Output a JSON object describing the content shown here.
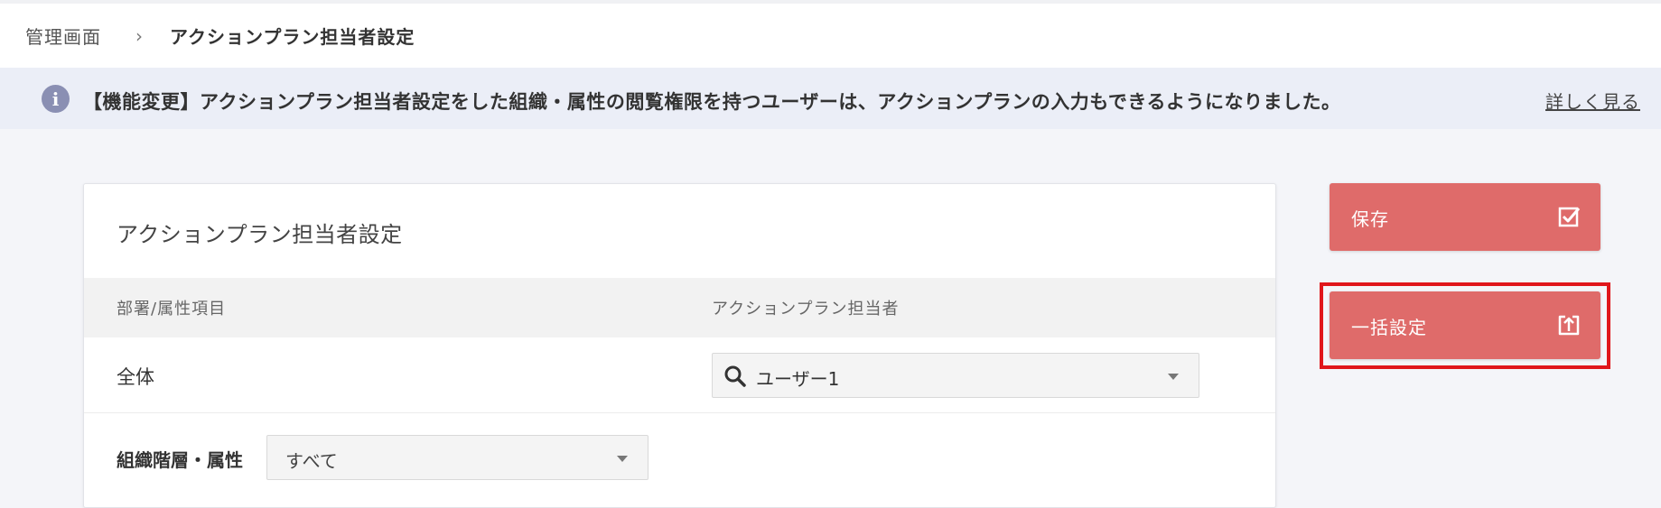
{
  "breadcrumb": {
    "root": "管理画面",
    "separator": "›",
    "current": "アクションプラン担当者設定"
  },
  "notice": {
    "icon": "info-icon",
    "text": "【機能変更】アクションプラン担当者設定をした組織・属性の閲覧権限を持つユーザーは、アクションプランの入力もできるようになりました。",
    "link": "詳しく見る"
  },
  "card": {
    "title": "アクションプラン担当者設定",
    "columns": {
      "dept": "部署/属性項目",
      "person": "アクションプラン担当者"
    },
    "rows": [
      {
        "label": "全体",
        "assignee": "ユーザー1"
      }
    ],
    "filter": {
      "label": "組織階層・属性",
      "value": "すべて"
    }
  },
  "actions": {
    "save": {
      "label": "保存",
      "icon": "checkbox-icon"
    },
    "bulk": {
      "label": "一括設定",
      "icon": "upload-icon"
    }
  },
  "colors": {
    "accent": "#df6b6a",
    "highlight": "#e0161b",
    "notice_bg": "#ebeef7",
    "page_bg": "#f4f5f9"
  }
}
